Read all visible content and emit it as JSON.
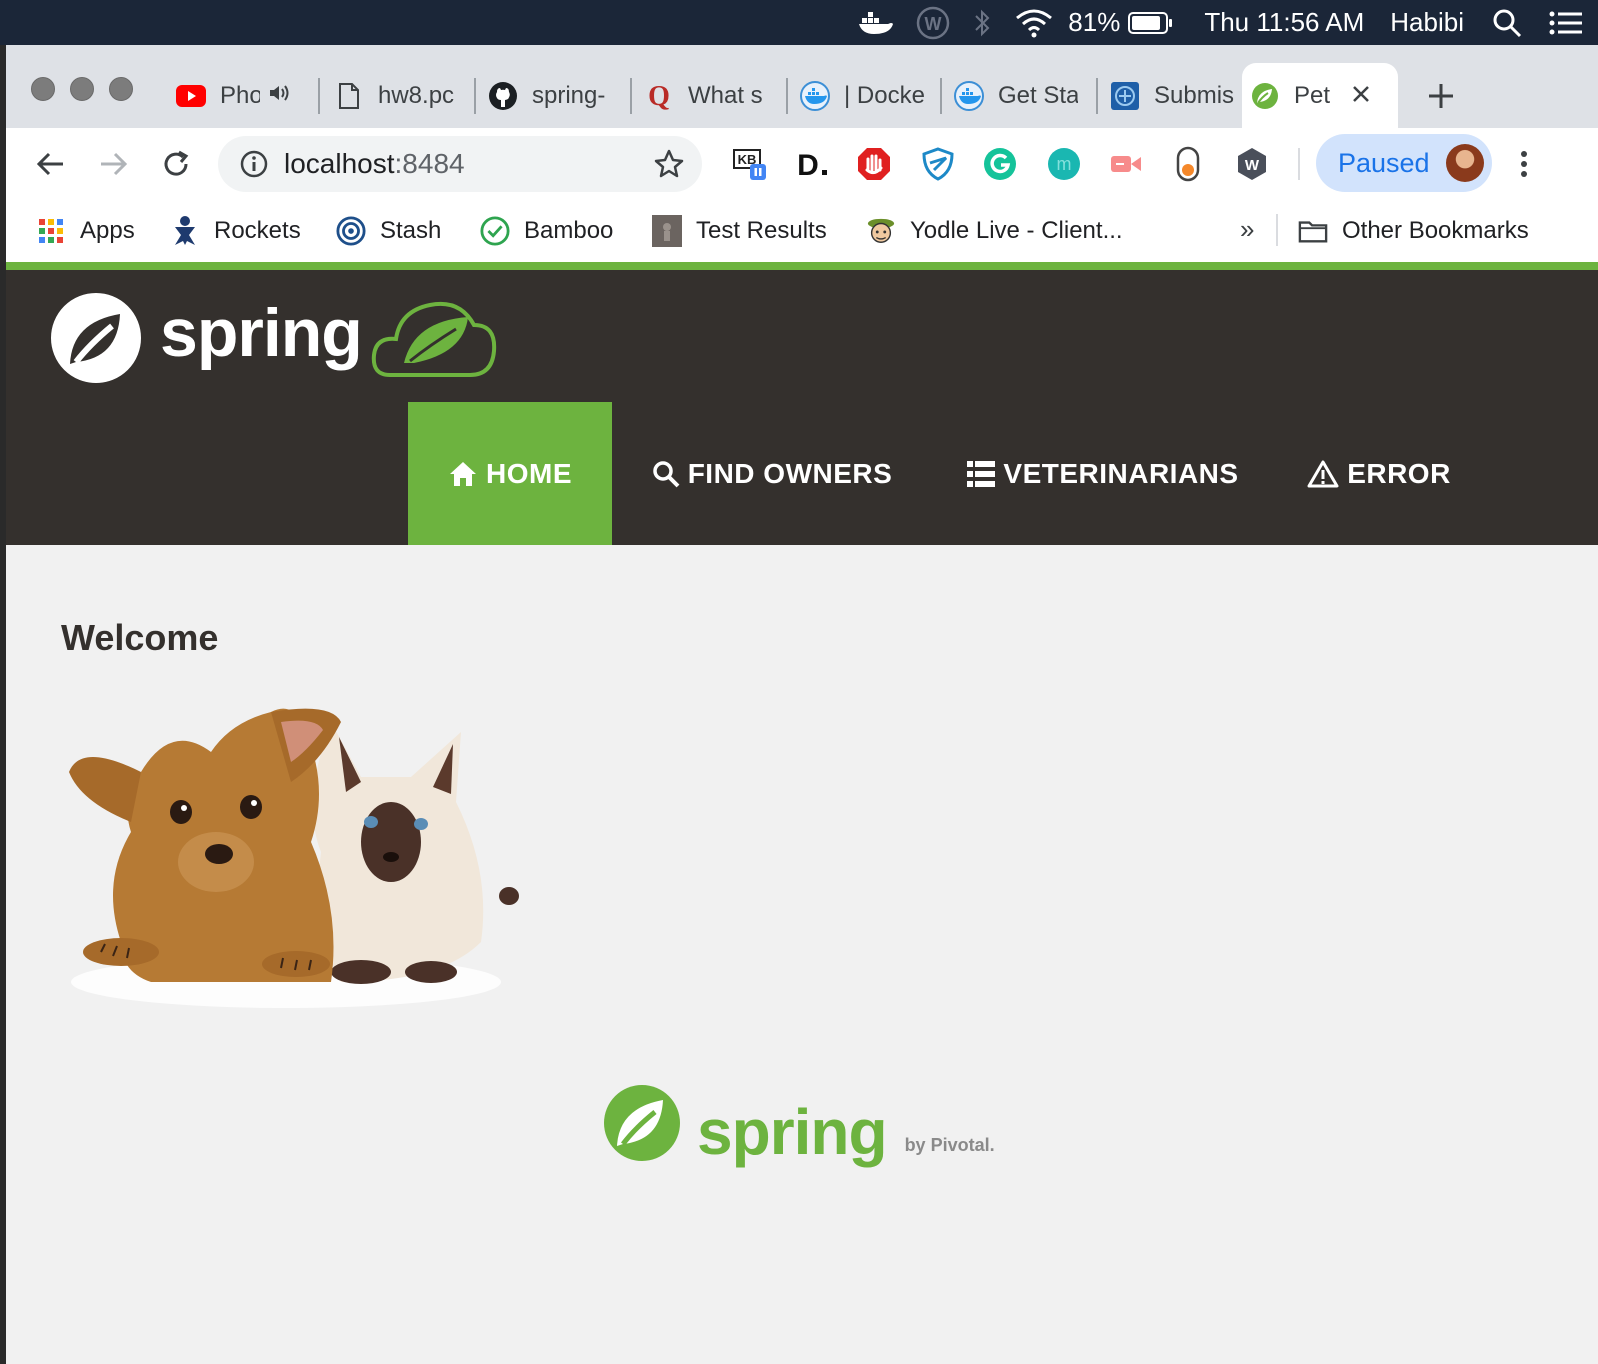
{
  "menubar": {
    "battery": "81%",
    "clock": "Thu 11:56 AM",
    "user": "Habibi"
  },
  "tabs": [
    {
      "label": "Pho",
      "icon": "youtube-icon"
    },
    {
      "label": "hw8.pc",
      "icon": "document-icon"
    },
    {
      "label": "spring-",
      "icon": "github-icon"
    },
    {
      "label": "What s",
      "icon": "quora-icon"
    },
    {
      "label": "| Docke",
      "icon": "docker-icon"
    },
    {
      "label": "Get Sta",
      "icon": "docker-icon"
    },
    {
      "label": "Submis",
      "icon": "submission-icon"
    },
    {
      "label": "Pet",
      "icon": "spring-leaf-icon"
    }
  ],
  "toolbar": {
    "url_host": "localhost",
    "url_port": ":8484",
    "paused_label": "Paused"
  },
  "bookmarks": [
    {
      "label": "Apps",
      "icon": "apps-grid-icon"
    },
    {
      "label": "Rockets",
      "icon": "rockets-icon"
    },
    {
      "label": "Stash",
      "icon": "stash-icon"
    },
    {
      "label": "Bamboo",
      "icon": "bamboo-icon"
    },
    {
      "label": "Test Results",
      "icon": "test-results-icon"
    },
    {
      "label": "Yodle Live - Client...",
      "icon": "yodle-icon"
    }
  ],
  "bookmarks_overflow": "»",
  "other_bookmarks": "Other Bookmarks",
  "site": {
    "brand": "spring",
    "nav": [
      {
        "label": "HOME",
        "icon": "home-icon",
        "active": true
      },
      {
        "label": "FIND OWNERS",
        "icon": "search-icon",
        "active": false
      },
      {
        "label": "VETERINARIANS",
        "icon": "list-icon",
        "active": false
      },
      {
        "label": "ERROR",
        "icon": "warning-icon",
        "active": false
      }
    ],
    "heading": "Welcome",
    "footer_brand": "spring",
    "footer_by": "by Pivotal."
  },
  "colors": {
    "spring_green": "#6db33f",
    "navbar_dark": "#34302d",
    "page_bg": "#f1f1f1"
  }
}
